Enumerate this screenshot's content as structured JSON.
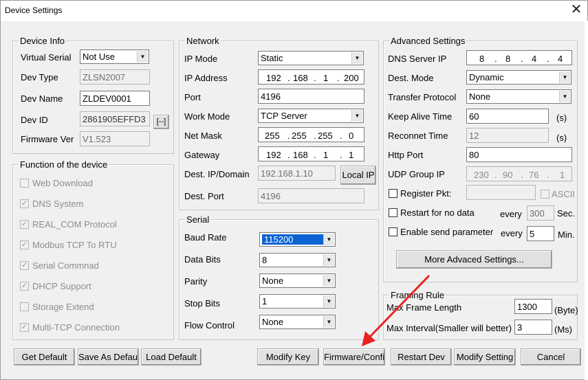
{
  "window": {
    "title": "Device Settings",
    "close_glyph": "✕"
  },
  "device_info": {
    "legend": "Device Info",
    "virtual_serial_label": "Virtual Serial",
    "virtual_serial_value": "Not Use",
    "dev_type_label": "Dev Type",
    "dev_type_value": "ZLSN2007",
    "dev_name_label": "Dev Name",
    "dev_name_value": "ZLDEV0001",
    "dev_id_label": "Dev ID",
    "dev_id_value": "2861905EFFD3",
    "dev_id_button": "[--]",
    "firmware_label": "Firmware Ver",
    "firmware_value": "V1.523"
  },
  "functions": {
    "legend": "Function of the device",
    "items": [
      {
        "label": "Web Download",
        "checked": ""
      },
      {
        "label": "DNS System",
        "checked": "✓"
      },
      {
        "label": "REAL_COM Protocol",
        "checked": "✓"
      },
      {
        "label": "Modbus TCP To RTU",
        "checked": "✓"
      },
      {
        "label": "Serial Commnad",
        "checked": "✓"
      },
      {
        "label": "DHCP Support",
        "checked": "✓"
      },
      {
        "label": "Storage Extend",
        "checked": ""
      },
      {
        "label": "Multi-TCP Connection",
        "checked": "✓"
      }
    ]
  },
  "network": {
    "legend": "Network",
    "ip_mode_label": "IP Mode",
    "ip_mode_value": "Static",
    "ip_address_label": "IP Address",
    "ip_address": [
      "192",
      "168",
      "1",
      "200"
    ],
    "port_label": "Port",
    "port_value": "4196",
    "work_mode_label": "Work Mode",
    "work_mode_value": "TCP Server",
    "net_mask_label": "Net Mask",
    "net_mask": [
      "255",
      "255",
      "255",
      "0"
    ],
    "gateway_label": "Gateway",
    "gateway": [
      "192",
      "168",
      "1",
      "1"
    ],
    "dest_ip_label": "Dest. IP/Domain",
    "dest_ip_value": "192.168.1.10",
    "local_ip_button": "Local IP",
    "dest_port_label": "Dest. Port",
    "dest_port_value": "4196"
  },
  "serial": {
    "legend": "Serial",
    "baud_rate_label": "Baud Rate",
    "baud_rate_value": "115200",
    "data_bits_label": "Data Bits",
    "data_bits_value": "8",
    "parity_label": "Parity",
    "parity_value": "None",
    "stop_bits_label": "Stop Bits",
    "stop_bits_value": "1",
    "flow_control_label": "Flow Control",
    "flow_control_value": "None"
  },
  "advanced": {
    "legend": "Advanced Settings",
    "dns_label": "DNS Server IP",
    "dns": [
      "8",
      "8",
      "4",
      "4"
    ],
    "dest_mode_label": "Dest. Mode",
    "dest_mode_value": "Dynamic",
    "transfer_label": "Transfer Protocol",
    "transfer_value": "None",
    "keep_alive_label": "Keep Alive Time",
    "keep_alive_value": "60",
    "keep_alive_unit": "(s)",
    "reconnect_label": "Reconnet Time",
    "reconnect_value": "12",
    "reconnect_unit": "(s)",
    "http_port_label": "Http Port",
    "http_port_value": "80",
    "udp_group_label": "UDP Group IP",
    "udp_group": [
      "230",
      "90",
      "76",
      "1"
    ],
    "register_label": "Register Pkt:",
    "ascii_label": "ASCII",
    "restart_label": "Restart for no data",
    "restart_every": "every",
    "restart_value": "300",
    "restart_unit": "Sec.",
    "send_param_label": "Enable send parameter",
    "send_every": "every",
    "send_value": "5",
    "send_unit": "Min.",
    "more_button": "More Advaced Settings..."
  },
  "framing": {
    "legend": "Framing Rule",
    "max_len_label": "Max Frame Length",
    "max_len_value": "1300",
    "max_len_unit": "(Byte)",
    "max_interval_label": "Max Interval(Smaller will better)",
    "max_interval_value": "3",
    "max_interval_unit": "(Ms)"
  },
  "buttons": {
    "get_default": "Get Default",
    "save_default": "Save As Default",
    "load_default": "Load Default",
    "modify_key": "Modify Key",
    "firmware_config": "Firmware/Config",
    "restart_dev": "Restart Dev",
    "modify_setting": "Modify Setting",
    "cancel": "Cancel"
  },
  "annotation": {
    "arrow_color": "#e8231f"
  }
}
